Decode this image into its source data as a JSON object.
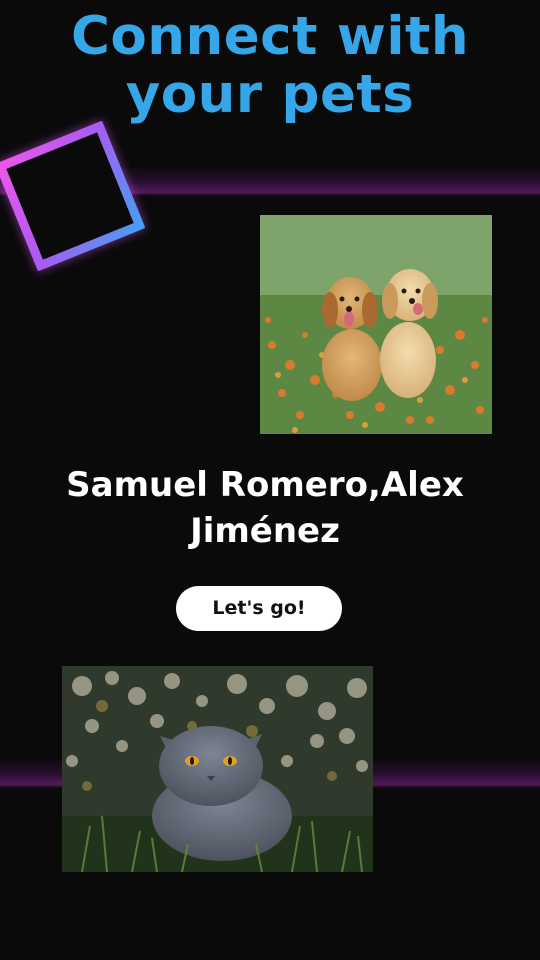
{
  "header": {
    "headline": "Connect with your pets"
  },
  "content": {
    "names": "Samuel Romero,Alex Jiménez",
    "cta_label": "Let's go!"
  },
  "images": {
    "top": "two-puppies-photo",
    "bottom": "gray-cat-photo"
  },
  "colors": {
    "background": "#0a0a0b",
    "headline": "#35a7e8",
    "button_bg": "#ffffff",
    "accent_gradient": [
      "#f356e8",
      "#a65cf2",
      "#3fa3f5"
    ]
  }
}
